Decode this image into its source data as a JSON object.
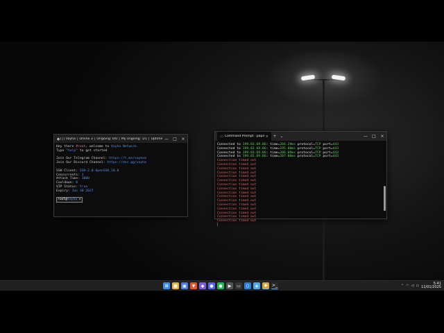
{
  "left_window": {
    "title": "[│] Vayha │ Online 3 │ Ongoing: 0/0 │ My ongoing: 1/1 │ Uptime: 1d 07...",
    "lines": [
      {
        "segments": [
          {
            "t": "Hey there ",
            "c": ""
          },
          {
            "t": "#root",
            "c": "c-pink"
          },
          {
            "t": ", welcome to ",
            "c": ""
          },
          {
            "t": "Vayha Network.",
            "c": "c-blue"
          }
        ]
      },
      {
        "segments": [
          {
            "t": "Type ",
            "c": ""
          },
          {
            "t": "\"help\"",
            "c": "c-blue"
          },
          {
            "t": " to get started",
            "c": ""
          }
        ]
      },
      {
        "segments": [
          {
            "t": "",
            "c": ""
          }
        ]
      },
      {
        "segments": [
          {
            "t": "Join Our Telegram Channel: ",
            "c": ""
          },
          {
            "t": "https://t.me/vayhaa",
            "c": "c-blue"
          }
        ]
      },
      {
        "segments": [
          {
            "t": "Join Our Discord Channel: ",
            "c": ""
          },
          {
            "t": "https://dsc.gg/vayha",
            "c": "c-blue"
          }
        ]
      },
      {
        "segments": [
          {
            "t": "",
            "c": ""
          }
        ]
      },
      {
        "segments": [
          {
            "t": "SSH Client: ",
            "c": ""
          },
          {
            "t": "SSH-2.0-OpenSSH_10.0",
            "c": "c-blue"
          }
        ]
      },
      {
        "segments": [
          {
            "t": "Concurrents: ",
            "c": ""
          },
          {
            "t": "1",
            "c": "c-blue"
          }
        ]
      },
      {
        "segments": [
          {
            "t": "Attack Time: ",
            "c": ""
          },
          {
            "t": "3000",
            "c": "c-blue"
          }
        ]
      },
      {
        "segments": [
          {
            "t": "Cooldown: ",
            "c": ""
          },
          {
            "t": "0",
            "c": "c-blue"
          }
        ]
      },
      {
        "segments": [
          {
            "t": "VIP Status: ",
            "c": ""
          },
          {
            "t": "true",
            "c": "c-blue"
          }
        ]
      },
      {
        "segments": [
          {
            "t": "Expiry: ",
            "c": ""
          },
          {
            "t": "Jan 30 2027",
            "c": "c-blue"
          }
        ]
      }
    ],
    "prompt_user": "root",
    "prompt_at": "@",
    "prompt_host": "Vayha",
    "prompt_suffix": " ▸"
  },
  "right_window": {
    "tab_title": "Command Prompt - paping",
    "tab_close": "×",
    "new_tab": "+",
    "dropdown": "⌄",
    "minimize": "—",
    "maximize": "□",
    "close": "×",
    "connected_lines": [
      {
        "prefix": "Connected to ",
        "ip": "199.83.69.86",
        "sep": ": time=",
        "time": "204.29ms",
        "proto_lbl": " protocol=",
        "proto": "TCP",
        "port_lbl": " port=",
        "port": "443"
      },
      {
        "prefix": "Connected to ",
        "ip": "199.83.69.86",
        "sep": ": time=",
        "time": "195.80ms",
        "proto_lbl": " protocol=",
        "proto": "TCP",
        "port_lbl": " port=",
        "port": "443"
      },
      {
        "prefix": "Connected to ",
        "ip": "199.83.69.86",
        "sep": ": time=",
        "time": "206.09ms",
        "proto_lbl": " protocol=",
        "proto": "TCP",
        "port_lbl": " port=",
        "port": "443"
      },
      {
        "prefix": "Connected to ",
        "ip": "199.83.69.86",
        "sep": ": time=",
        "time": "207.00ms",
        "proto_lbl": " protocol=",
        "proto": "TCP",
        "port_lbl": " port=",
        "port": "443"
      }
    ],
    "timeout_lines": [
      "Connection timed out",
      "Connection timed out",
      "Connection timed out",
      "Connection timed out",
      "Connection timed out",
      "Connection timed out",
      "Connection timed out",
      "Connection timed out",
      "Connection timed out",
      "Connection timed out",
      "Connection timed out",
      "Connection timed out",
      "Connection timed out",
      "Connection timed out",
      "Connection timed out",
      "Connection timed out"
    ]
  },
  "left_controls": {
    "minimize": "—",
    "maximize": "□",
    "close": "×"
  },
  "taskbar": {
    "icons": [
      {
        "name": "start-icon",
        "glyph": "⊞",
        "color": "#3b8eea"
      },
      {
        "name": "file-explorer-icon",
        "glyph": "■",
        "color": "#e3b341"
      },
      {
        "name": "store-icon",
        "glyph": "▣",
        "color": "#4a7cdc"
      },
      {
        "name": "brave-browser-icon",
        "glyph": "▼",
        "color": "#e5532d"
      },
      {
        "name": "photos-icon",
        "glyph": "◆",
        "color": "#7d5ce0"
      },
      {
        "name": "discord-icon",
        "glyph": "●",
        "color": "#5865f2"
      },
      {
        "name": "spotify-icon",
        "glyph": "●",
        "color": "#1db954"
      },
      {
        "name": "media-icon",
        "glyph": "▶",
        "color": "#555555"
      },
      {
        "name": "terminal-icon",
        "glyph": "▭",
        "color": "#333333"
      },
      {
        "name": "vscode-icon",
        "glyph": "⟨⟩",
        "color": "#2b7fd6"
      },
      {
        "name": "app-icon",
        "glyph": "◈",
        "color": "#4aa3f0"
      },
      {
        "name": "vayha-icon",
        "glyph": "◆",
        "color": "#d2a43a"
      },
      {
        "name": "command-prompt-icon",
        "glyph": ">_",
        "color": "#2a2a2a"
      }
    ],
    "tray": {
      "chevron": "⌃",
      "wifi": "◠",
      "volume": "◁",
      "battery": "▭",
      "time": "5:41",
      "date": "11/01/2025"
    }
  }
}
